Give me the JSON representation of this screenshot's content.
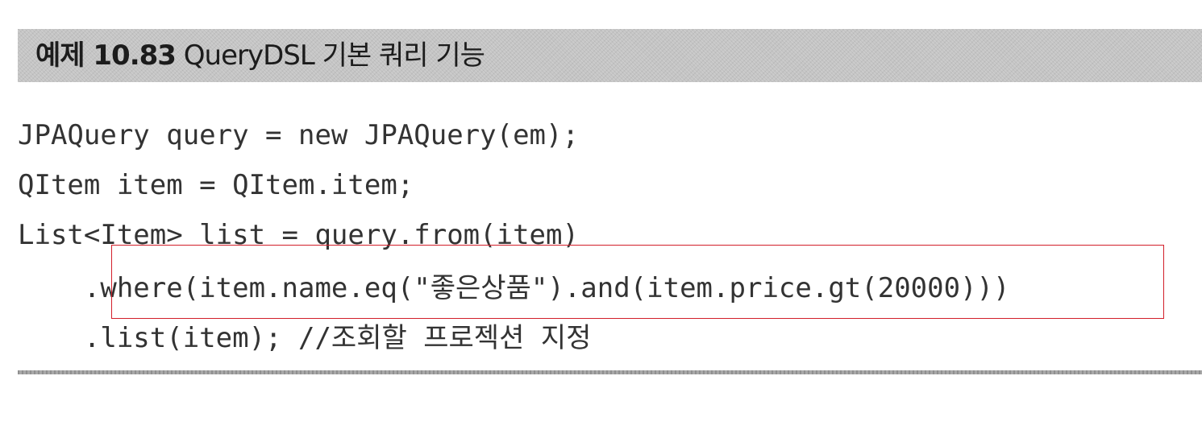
{
  "example": {
    "label": "예제 10.83",
    "title": "QueryDSL 기본 쿼리 기능"
  },
  "code": {
    "lines": [
      "JPAQuery query = new JPAQuery(em);",
      "QItem item = QItem.item;",
      "List<Item> list = query.from(item)",
      "    .where(item.name.eq(\"좋은상품\").and(item.price.gt(20000)))",
      "    .list(item); //조회할 프로젝션 지정"
    ]
  },
  "colors": {
    "title_background": "#c4c4c4",
    "highlight_border": "#d21f2a",
    "code_text": "#333333"
  }
}
